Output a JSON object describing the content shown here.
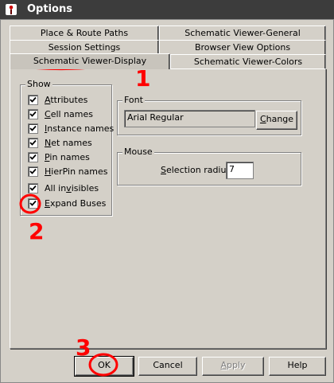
{
  "window": {
    "title": "Options"
  },
  "tabs": {
    "row1": [
      "Place & Route Paths",
      "Schematic Viewer-General"
    ],
    "row2": [
      "Session Settings",
      "Browser View Options"
    ],
    "row3": [
      "Schematic Viewer-Display",
      "Schematic Viewer-Colors"
    ],
    "active": "Schematic Viewer-Display"
  },
  "show": {
    "title": "Show",
    "items": [
      {
        "mn": "A",
        "rest": "ttributes",
        "checked": true
      },
      {
        "mn": "C",
        "rest": "ell names",
        "checked": true
      },
      {
        "mn": "I",
        "rest": "nstance names",
        "checked": true
      },
      {
        "mn": "N",
        "rest": "et names",
        "checked": true
      },
      {
        "mn": "P",
        "rest": "in names",
        "checked": true
      },
      {
        "mn": "H",
        "rest": "ierPin names",
        "checked": true
      },
      {
        "pre": "All in",
        "mn": "v",
        "rest": "isibles",
        "checked": true
      },
      {
        "pre": "",
        "mn": "E",
        "rest": "xpand Buses",
        "checked": true
      }
    ]
  },
  "font": {
    "title": "Font",
    "value": "Arial Regular",
    "change_mn": "C",
    "change_rest": "hange"
  },
  "mouse": {
    "title": "Mouse",
    "label_mn": "S",
    "label_rest": "election radius:",
    "value": "7"
  },
  "buttons": {
    "ok": "OK",
    "cancel": "Cancel",
    "apply_mn": "A",
    "apply_rest": "pply",
    "help": "Help"
  },
  "annotations": [
    "1",
    "2",
    "3"
  ],
  "colors": {
    "title_bg": "#3c3c3c",
    "face": "#d4d0c8",
    "ink": "#ff0000"
  }
}
